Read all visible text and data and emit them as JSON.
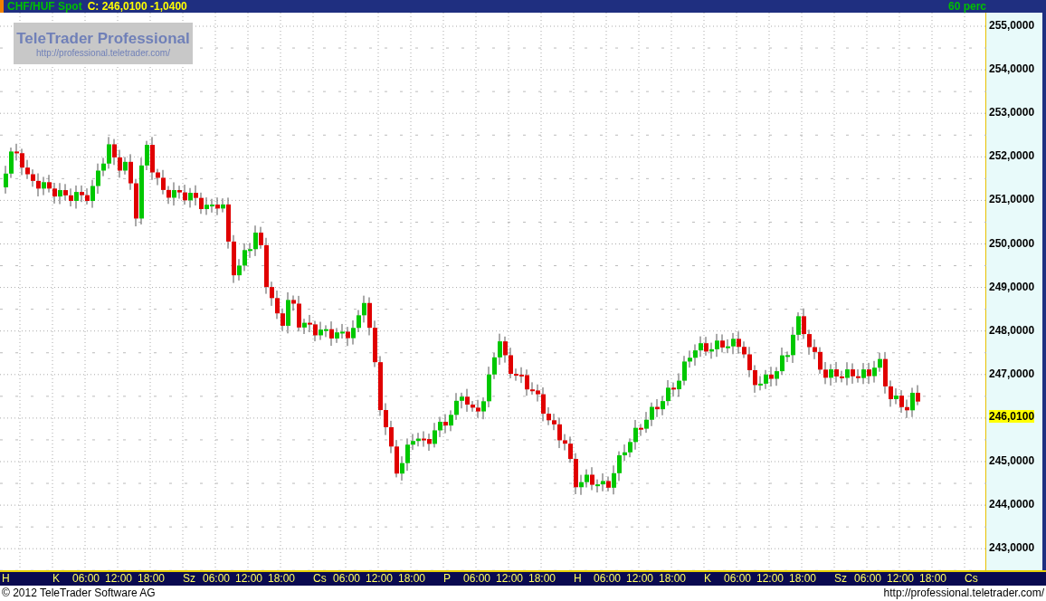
{
  "title_bar": {
    "symbol": "CHF/HUF Spot",
    "quote": "C: 246,0100 -1,0400",
    "interval": "60 perc"
  },
  "logo": {
    "name": "TeleTrader Professional",
    "url": "http://professional.teletrader.com/"
  },
  "price_axis": {
    "ticks": [
      "255,0000",
      "254,0000",
      "253,0000",
      "252,0000",
      "251,0000",
      "250,0000",
      "249,0000",
      "248,0000",
      "247,0000",
      "245,0000",
      "244,0000",
      "243,0000"
    ],
    "current_price": "246,0100"
  },
  "time_axis": [
    {
      "text": "H",
      "kind": "day"
    },
    {
      "text": "K",
      "kind": "day"
    },
    {
      "text": "06:00",
      "kind": "time"
    },
    {
      "text": "12:00",
      "kind": "time"
    },
    {
      "text": "18:00",
      "kind": "time"
    },
    {
      "text": "Sz",
      "kind": "day"
    },
    {
      "text": "06:00",
      "kind": "time"
    },
    {
      "text": "12:00",
      "kind": "time"
    },
    {
      "text": "18:00",
      "kind": "time"
    },
    {
      "text": "Cs",
      "kind": "day"
    },
    {
      "text": "06:00",
      "kind": "time"
    },
    {
      "text": "12:00",
      "kind": "time"
    },
    {
      "text": "18:00",
      "kind": "time"
    },
    {
      "text": "P",
      "kind": "day"
    },
    {
      "text": "06:00",
      "kind": "time"
    },
    {
      "text": "12:00",
      "kind": "time"
    },
    {
      "text": "18:00",
      "kind": "time"
    },
    {
      "text": "H",
      "kind": "day"
    },
    {
      "text": "06:00",
      "kind": "time"
    },
    {
      "text": "12:00",
      "kind": "time"
    },
    {
      "text": "18:00",
      "kind": "time"
    },
    {
      "text": "K",
      "kind": "day"
    },
    {
      "text": "06:00",
      "kind": "time"
    },
    {
      "text": "12:00",
      "kind": "time"
    },
    {
      "text": "18:00",
      "kind": "time"
    },
    {
      "text": "Sz",
      "kind": "day"
    },
    {
      "text": "06:00",
      "kind": "time"
    },
    {
      "text": "12:00",
      "kind": "time"
    },
    {
      "text": "18:00",
      "kind": "time"
    },
    {
      "text": "Cs",
      "kind": "day"
    }
  ],
  "footer": {
    "copyright": "© 2012 TeleTrader Software AG",
    "url": "http://professional.teletrader.com/"
  }
}
